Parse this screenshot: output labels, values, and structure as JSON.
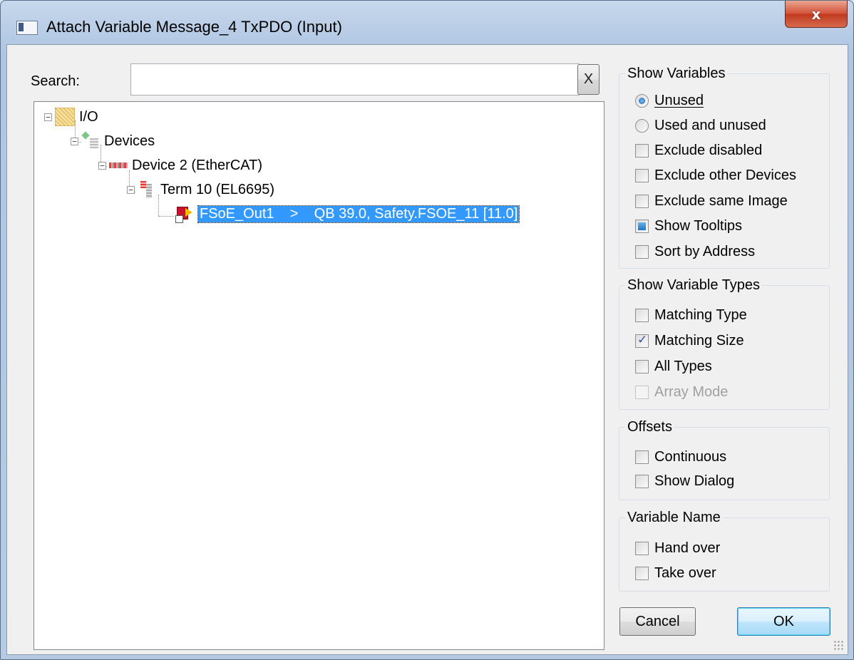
{
  "window": {
    "title": "Attach Variable Message_4 TxPDO (Input)",
    "close_label": "x"
  },
  "search": {
    "label": "Search:",
    "value": "",
    "clear_label": "X"
  },
  "tree": {
    "nodes": [
      {
        "label": "I/O"
      },
      {
        "label": "Devices"
      },
      {
        "label": "Device 2 (EtherCAT)"
      },
      {
        "label": "Term 10 (EL6695)"
      },
      {
        "label": "FSoE_Out1    >    QB 39.0, Safety.FSOE_11 [11.0]"
      }
    ]
  },
  "show_variables": {
    "title": "Show Variables",
    "unused": "Unused",
    "used_and_unused": "Used and unused",
    "exclude_disabled": "Exclude disabled",
    "exclude_other_devices": "Exclude other Devices",
    "exclude_same_image": "Exclude same Image",
    "show_tooltips": "Show Tooltips",
    "sort_by_address": "Sort by Address"
  },
  "show_variable_types": {
    "title": "Show Variable Types",
    "matching_type": "Matching Type",
    "matching_size": "Matching Size",
    "all_types": "All Types",
    "array_mode": "Array Mode"
  },
  "offsets": {
    "title": "Offsets",
    "continuous": "Continuous",
    "show_dialog": "Show Dialog"
  },
  "variable_name": {
    "title": "Variable Name",
    "hand_over": "Hand over",
    "take_over": "Take over"
  },
  "buttons": {
    "cancel": "Cancel",
    "ok": "OK"
  }
}
